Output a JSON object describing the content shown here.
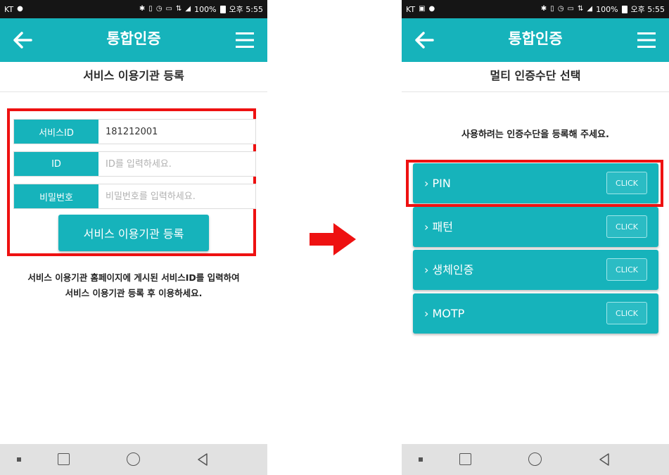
{
  "status_bar": {
    "carrier": "KT",
    "battery": "100%",
    "time": "오후 5:55",
    "icons": [
      "chat-bubble-icon",
      "bluetooth-icon",
      "vibrate-icon",
      "alarm-icon",
      "volte-icon",
      "lte-icon",
      "signal-icon",
      "battery-icon"
    ]
  },
  "left_screen": {
    "header": {
      "title": "통합인증",
      "back_icon": "arrow-left-icon",
      "menu_icon": "hamburger-menu-icon"
    },
    "subheader": "서비스 이용기관 등록",
    "form": {
      "rows": [
        {
          "label": "서비스ID",
          "value": "181212001",
          "placeholder": ""
        },
        {
          "label": "ID",
          "value": "",
          "placeholder": "ID를 입력하세요."
        },
        {
          "label": "비밀번호",
          "value": "",
          "placeholder": "비밀번호를 입력하세요."
        }
      ],
      "submit_label": "서비스 이용기관 등록"
    },
    "info_lines": [
      "서비스 이용기관 홈페이지에 게시된 서비스ID를 입력하여",
      "서비스 이용기관 등록 후 이용하세요."
    ]
  },
  "right_screen": {
    "header": {
      "title": "통합인증",
      "back_icon": "arrow-left-icon",
      "menu_icon": "hamburger-menu-icon"
    },
    "subheader": "멀티 인증수단 선택",
    "prompt": "사용하려는 인증수단을 등록해 주세요.",
    "options": [
      {
        "label": "› PIN",
        "button": "CLICK"
      },
      {
        "label": "› 패턴",
        "button": "CLICK"
      },
      {
        "label": "› 생체인증",
        "button": "CLICK"
      },
      {
        "label": "› MOTP",
        "button": "CLICK"
      }
    ]
  },
  "colors": {
    "accent": "#16b3bb",
    "highlight": "#ee1111",
    "status_bar": "#151515",
    "nav_bar": "#e1e1e1"
  }
}
